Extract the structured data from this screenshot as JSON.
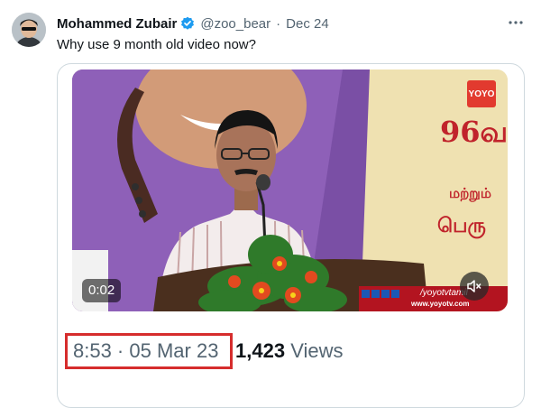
{
  "tweet": {
    "author_name": "Mohammed Zubair",
    "handle": "@zoo_bear",
    "separator": "·",
    "date": "Dec 24",
    "text": "Why use 9 month old video now?",
    "verified_icon": "verified-badge-icon",
    "more_icon": "more-options-icon"
  },
  "video": {
    "duration": "0:02",
    "channel_logo": "YOYO",
    "banner_lines": [
      "96வ",
      "மற்றும்",
      "பெரு"
    ],
    "social_handle": "/yoyotvtamil",
    "url": "www.yoyotv.com",
    "mute_icon": "muted-speaker-icon"
  },
  "meta": {
    "timestamp": "8:53 · 05 Mar 23",
    "view_count": "1,423",
    "views_label": "Views"
  },
  "colors": {
    "verified": "#1d9bf0",
    "highlight_box": "#d62d2d",
    "secondary_text": "#536471",
    "banner_text": "#c0232b"
  }
}
